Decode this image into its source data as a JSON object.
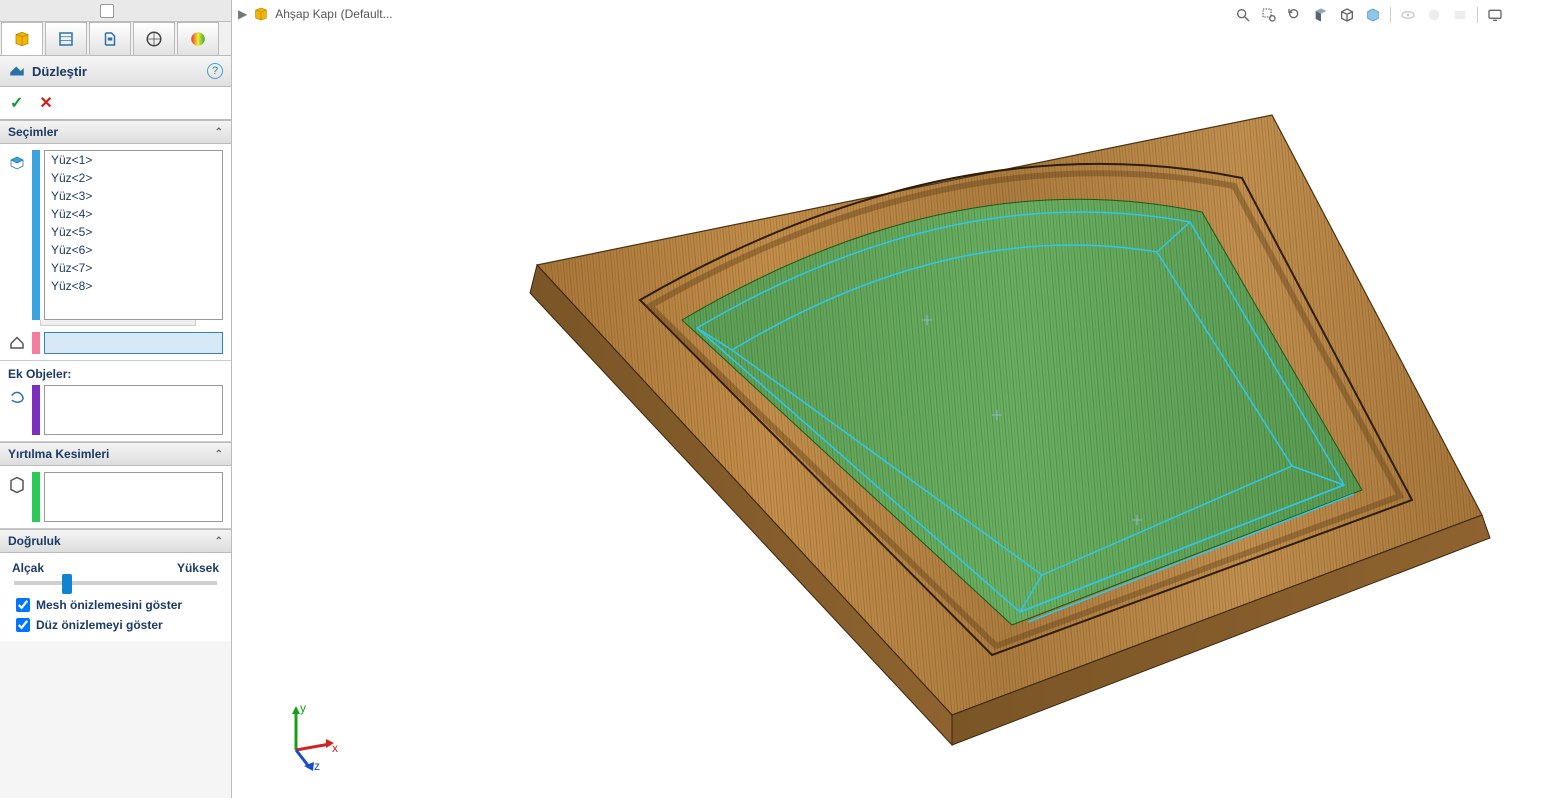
{
  "breadcrumb": {
    "part_name": "Ahşap Kapı  (Default..."
  },
  "feature": {
    "title": "Düzleştir",
    "help_glyph": "?",
    "ok_glyph": "✓",
    "cancel_glyph": "✕"
  },
  "sections": {
    "selections": {
      "title": "Seçimler",
      "items": [
        "Yüz<1>",
        "Yüz<2>",
        "Yüz<3>",
        "Yüz<4>",
        "Yüz<5>",
        "Yüz<6>",
        "Yüz<7>",
        "Yüz<8>"
      ],
      "input_value": ""
    },
    "extra_objects": {
      "label": "Ek Objeler:"
    },
    "tear_cuts": {
      "title": "Yırtılma Kesimleri"
    },
    "accuracy": {
      "title": "Doğruluk",
      "low": "Alçak",
      "high": "Yüksek"
    }
  },
  "checks": {
    "mesh": "Mesh önizlemesini göster",
    "flat": "Düz önizlemeyi göster"
  },
  "triad": {
    "x": "x",
    "y": "y",
    "z": "z"
  }
}
